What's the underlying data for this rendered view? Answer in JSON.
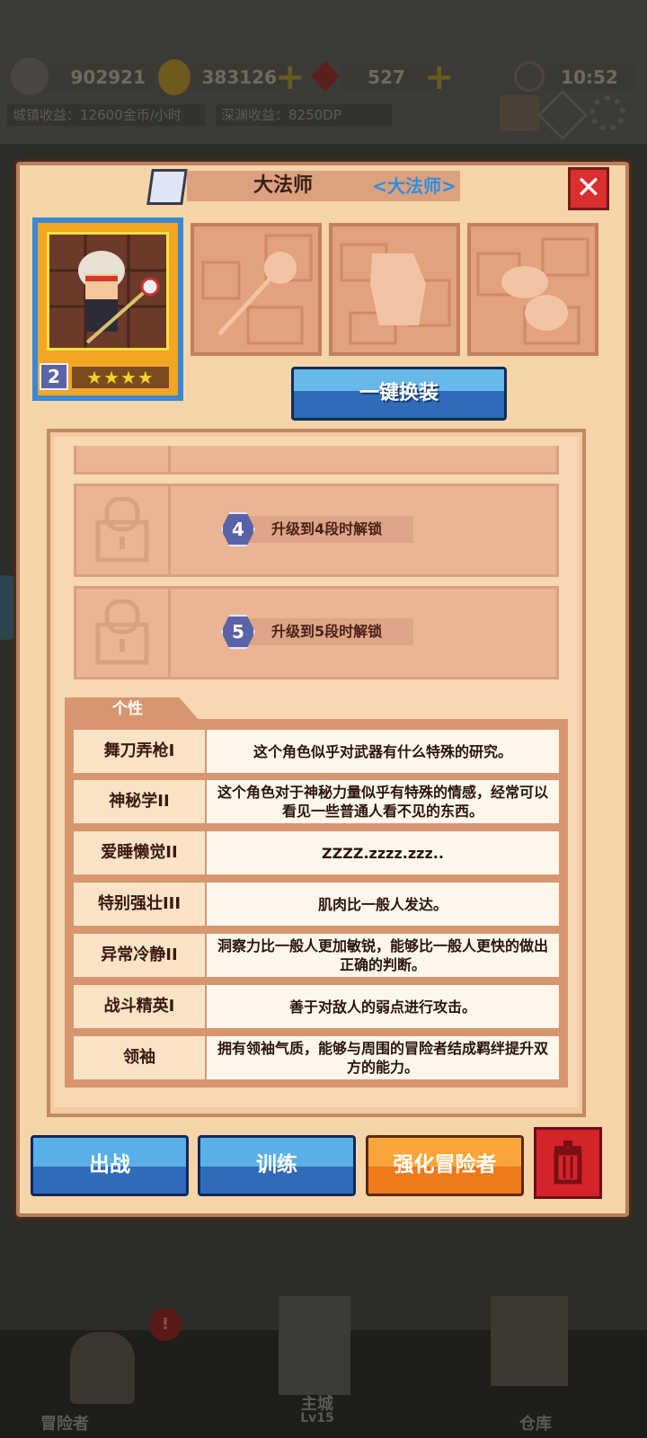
{
  "hud": {
    "power_value": "902921",
    "gold_value": "383126",
    "gem_value": "527",
    "clock": "10:52",
    "city_income": "城镇收益：12600金币/小时",
    "abyss_income": "深渊收益：8250DP"
  },
  "panel": {
    "title": "大法师",
    "class_label": "<大法师>",
    "close_label": "✕"
  },
  "hero": {
    "level": "2",
    "stars": "★★★★"
  },
  "equip_button": "一键换装",
  "locked_skills": [
    {
      "num": "4",
      "text": "升级到4段时解锁"
    },
    {
      "num": "5",
      "text": "升级到5段时解锁"
    }
  ],
  "traits_tab": "个性",
  "traits": [
    {
      "name": "舞刀弄枪I",
      "desc": "这个角色似乎对武器有什么特殊的研究。"
    },
    {
      "name": "神秘学II",
      "desc": "这个角色对于神秘力量似乎有特殊的情感，经常可以看见一些普通人看不见的东西。"
    },
    {
      "name": "爱睡懒觉II",
      "desc": "ZZZZ.zzzz.zzz.."
    },
    {
      "name": "特别强壮III",
      "desc": "肌肉比一般人发达。"
    },
    {
      "name": "异常冷静II",
      "desc": "洞察力比一般人更加敏锐，能够比一般人更快的做出正确的判断。"
    },
    {
      "name": "战斗精英I",
      "desc": "善于对敌人的弱点进行攻击。"
    },
    {
      "name": "领袖",
      "desc": "拥有领袖气质，能够与周围的冒险者结成羁绊提升双方的能力。"
    }
  ],
  "actions": {
    "deploy": "出战",
    "train": "训练",
    "enhance": "强化冒险者"
  },
  "bottom_nav": {
    "adventurers": "冒险者",
    "main_city": "主城",
    "city_level": "Lv15",
    "warehouse": "仓库"
  },
  "colors": {
    "panel_bg": "#f6d4a9",
    "blue_button": "#2f6bb8",
    "orange_button": "#ee7a1c",
    "red_button": "#d3242a"
  }
}
